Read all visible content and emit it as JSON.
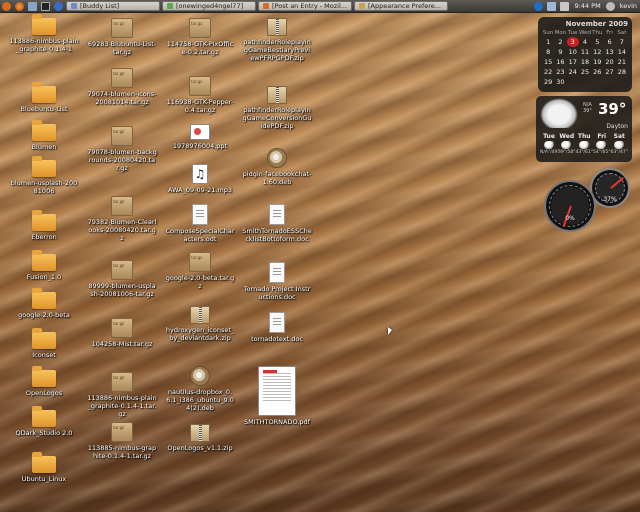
{
  "panel": {
    "tasks": [
      {
        "label": "[Buddy List]",
        "color": "#6b8cc9"
      },
      {
        "label": "[onewinged4ngel77]",
        "color": "#5aa850"
      },
      {
        "label": "[Post an Entry - Mozil...",
        "color": "#d86a2a"
      },
      {
        "label": "[Appearance Prefere...",
        "color": "#c9a24f"
      }
    ],
    "time": "9:44 PM",
    "user": "kevin"
  },
  "desktop": {
    "col1": [
      {
        "label": "113886-nimbus-plain_graphite-0.1.4-1",
        "type": "folder"
      },
      {
        "label": "Bluebuntu-List",
        "type": "folder"
      },
      {
        "label": "Blumen",
        "type": "folder"
      },
      {
        "label": "blumen-usplash-20081006",
        "type": "folder"
      },
      {
        "label": "Eberron",
        "type": "folder"
      },
      {
        "label": "Fusion_1.0",
        "type": "folder"
      },
      {
        "label": "google-2.0-beta",
        "type": "folder"
      },
      {
        "label": "Iconset",
        "type": "folder"
      },
      {
        "label": "OpenLogos",
        "type": "folder"
      },
      {
        "label": "QDark_Studio 2.0",
        "type": "folder"
      },
      {
        "label": "Ubuntu_Linux",
        "type": "folder"
      }
    ],
    "col2": [
      {
        "label": "69283-Blubuntu-List-tar.gz",
        "type": "targz"
      },
      {
        "label": "79074-blumen-icons-20081014.tar.gz",
        "type": "targz"
      },
      {
        "label": "79078-blumen-backgrounds-20080420.tar.gz",
        "type": "targz"
      },
      {
        "label": "79382-Blumen-Clearlooks-20080420.tar.gz",
        "type": "targz"
      },
      {
        "label": "89999-blumen-usplash-20081006-tar.gz",
        "type": "targz"
      },
      {
        "label": "104258-Mist.tar.gz",
        "type": "targz"
      },
      {
        "label": "113886-nimbus-plain_graphite-0.1.4-1.tar.gz",
        "type": "targz"
      },
      {
        "label": "113885-nimbus-graphite-0.1.4-1.tar.gz",
        "type": "targz"
      }
    ],
    "col3": [
      {
        "label": "114758-GTK-PixOffice-0.2.tar.gz",
        "type": "targz"
      },
      {
        "label": "116938-GTK-Pepper-0.4.tar.gz",
        "type": "targz"
      },
      {
        "label": "1978976004.ppt",
        "type": "ppt"
      },
      {
        "label": "AWA_09-09-21.mp3",
        "type": "mp3"
      },
      {
        "label": "ComposeSpecialCharacters.odt",
        "type": "doc"
      },
      {
        "label": "google-2.0-beta.tar.gz",
        "type": "targz"
      },
      {
        "label": "hydroxygen_iconset_by_deviantdark.zip",
        "type": "zip"
      },
      {
        "label": "nautilus-dropbox_0.6.1_i386_ubuntu_9.04(2).deb",
        "type": "deb"
      },
      {
        "label": "OpenLogos_v1.1.zip",
        "type": "zip"
      }
    ],
    "col4": [
      {
        "label": "pathfinderRoleplayingGameBestiaryPreviewPFRPGPDF.zip",
        "type": "zip"
      },
      {
        "label": "pathfinderRoleplayingGameConversionGuidePDF.zip",
        "type": "zip"
      },
      {
        "label": "pidgin-facebookchat-1.60.deb",
        "type": "deb"
      },
      {
        "label": "SmithTornadoESSChecklistBottoform.doc",
        "type": "doc"
      },
      {
        "label": "Tornado Project Instructions.doc",
        "type": "doc"
      },
      {
        "label": "tornadotext.doc",
        "type": "doc"
      },
      {
        "label": "SMITHTORNADO.pdf",
        "type": "pdf"
      }
    ]
  },
  "calendar": {
    "title": "November 2009",
    "days": [
      "Sun",
      "Mon",
      "Tue",
      "Wed",
      "Thu",
      "Fri",
      "Sat"
    ],
    "weeks": [
      [
        "1",
        "2",
        "3",
        "4",
        "5",
        "6",
        "7"
      ],
      [
        "8",
        "9",
        "10",
        "11",
        "12",
        "13",
        "14"
      ],
      [
        "15",
        "16",
        "17",
        "18",
        "19",
        "20",
        "21"
      ],
      [
        "22",
        "23",
        "24",
        "25",
        "26",
        "27",
        "28"
      ],
      [
        "29",
        "30",
        "",
        "",
        "",
        "",
        ""
      ]
    ],
    "today": "3"
  },
  "weather": {
    "temp": "39°",
    "hi_lo": "N/A\n39°",
    "city": "Dayton",
    "forecast": [
      {
        "day": "Tue",
        "temps": "N/A°/49°"
      },
      {
        "day": "Wed",
        "temps": "39°/58°"
      },
      {
        "day": "Thu",
        "temps": "43°/61°"
      },
      {
        "day": "Fri",
        "temps": "54°/65°"
      },
      {
        "day": "Sat",
        "temps": "63°/47°"
      }
    ]
  },
  "gauges": {
    "cpu_value": "0%",
    "mem_value": "37%"
  }
}
